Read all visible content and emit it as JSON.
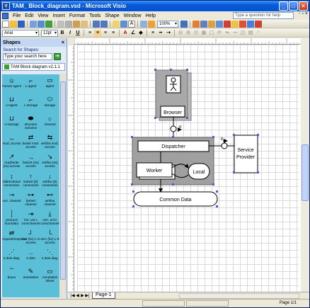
{
  "window": {
    "title": "TAM_ Block_diagram.vsd - Microsoft Visio"
  },
  "menu": {
    "items": [
      "File",
      "Edit",
      "View",
      "Insert",
      "Format",
      "Tools",
      "Shape",
      "Window",
      "Help"
    ],
    "help_placeholder": "Type a question for help"
  },
  "toolbar": {
    "zoom": "100%",
    "font": "Arial",
    "font_size": "12pt"
  },
  "shapes_pane": {
    "title": "Shapes",
    "search_label": "Search for Shapes:",
    "search_placeholder": "Type your search here",
    "stencil_name": "TAM Block diagram v2.1.1",
    "items": [
      {
        "label": "human agent",
        "glyph": "☺"
      },
      {
        "label": "L-agent",
        "glyph": "⌐"
      },
      {
        "label": "agent",
        "glyph": "▭"
      },
      {
        "label": "U-agent",
        "glyph": "⊔"
      },
      {
        "label": "L-storage",
        "glyph": "⌐"
      },
      {
        "label": "storage",
        "glyph": "⬭"
      },
      {
        "label": "U-storage",
        "glyph": "⊔"
      },
      {
        "label": "structure variance",
        "glyph": "⬬"
      },
      {
        "label": "channel",
        "glyph": "○"
      },
      {
        "label": "mod. access",
        "glyph": "↔"
      },
      {
        "label": "bw/wr mod. access",
        "glyph": "⇄"
      },
      {
        "label": "wrt/bw mod. access",
        "glyph": "⇆"
      },
      {
        "label": "read/write (rw) access",
        "glyph": "↗"
      },
      {
        "label": "bw/wrt (rw) access",
        "glyph": "→"
      },
      {
        "label": "wrt/bw (rw) access",
        "glyph": "↘"
      },
      {
        "label": "bidirectional connection",
        "glyph": "↕"
      },
      {
        "label": "bw/wrt (b) connection",
        "glyph": "↑"
      },
      {
        "label": "wrt/bw (b) connection",
        "glyph": "↓"
      },
      {
        "label": "con. channel",
        "glyph": "⊸"
      },
      {
        "label": "bw/wrt channel",
        "glyph": "⊶"
      },
      {
        "label": "wrt/bw channel",
        "glyph": "⊷"
      },
      {
        "label": "protocol boundary",
        "glyph": "┆"
      },
      {
        "label": "hor. uni-c connchannel",
        "glyph": "⇥"
      },
      {
        "label": "vert. uni-c connchannel",
        "glyph": "⤓"
      },
      {
        "label": "request/response",
        "glyph": "⇌"
      },
      {
        "label": "hor. (hv) L-S access",
        "glyph": "┘"
      },
      {
        "label": "vert. (hv) L-S access",
        "glyph": "└"
      },
      {
        "label": "2 dots diag.",
        "glyph": "⋰"
      },
      {
        "label": "2 dots",
        "glyph": "‥"
      },
      {
        "label": "2 dots diag.",
        "glyph": "⋱"
      },
      {
        "label": "brace",
        "glyph": "⏞"
      },
      {
        "label": "annotation",
        "glyph": "✎"
      },
      {
        "label": "Annotation Sheet",
        "glyph": "▭"
      }
    ]
  },
  "diagram": {
    "browser": "Browser",
    "dispatcher": "Dispatcher",
    "service_provider": "Service\nProvider",
    "worker": "Worker",
    "local": "Local",
    "common_data": "Common Data",
    "req_label": "R"
  },
  "tabs": {
    "page": "Page-1"
  },
  "status": {
    "page": "Page 1/1"
  }
}
